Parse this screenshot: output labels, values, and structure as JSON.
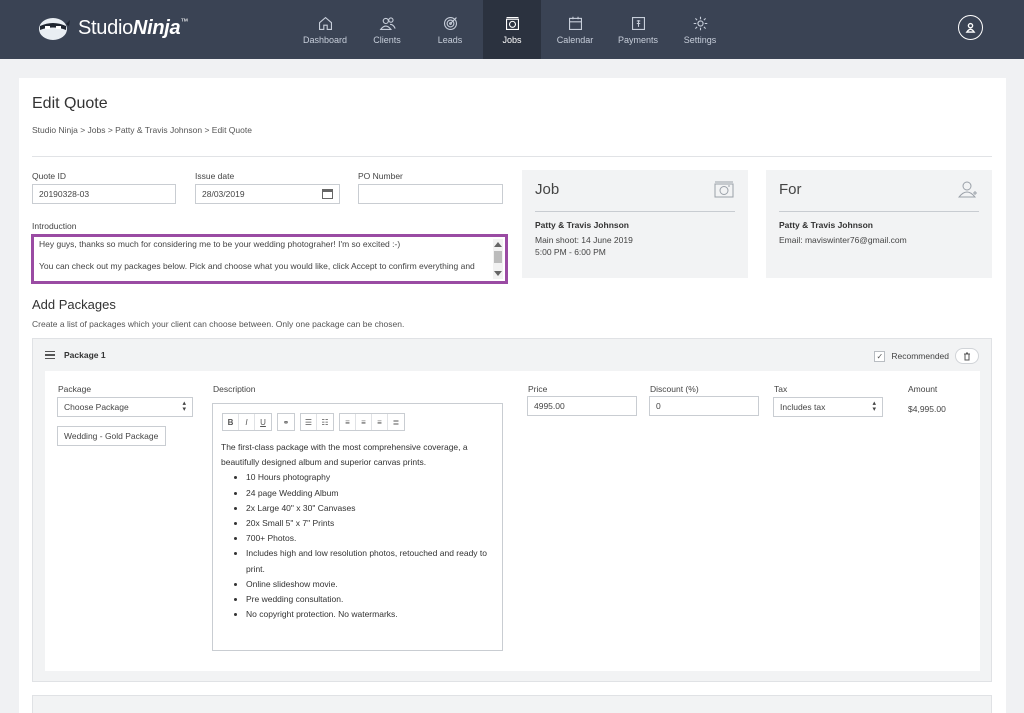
{
  "app": {
    "brand_prefix": "Studio",
    "brand_suffix": "Ninja",
    "brand_mark": "™"
  },
  "nav": [
    {
      "label": "Dashboard",
      "icon": "home-icon"
    },
    {
      "label": "Clients",
      "icon": "clients-icon"
    },
    {
      "label": "Leads",
      "icon": "target-icon"
    },
    {
      "label": "Jobs",
      "icon": "camera-icon",
      "active": true
    },
    {
      "label": "Calendar",
      "icon": "calendar-icon"
    },
    {
      "label": "Payments",
      "icon": "payments-icon"
    },
    {
      "label": "Settings",
      "icon": "gear-icon"
    }
  ],
  "page": {
    "title": "Edit Quote",
    "breadcrumb": "Studio Ninja  >  Jobs  >  Patty & Travis Johnson  >  Edit Quote"
  },
  "quote": {
    "id_label": "Quote ID",
    "id_value": "20190328-03",
    "issue_label": "Issue date",
    "issue_value": "28/03/2019",
    "po_label": "PO Number",
    "po_value": "",
    "intro_label": "Introduction",
    "intro_line1": "Hey guys, thanks so much for considering me to be your wedding photograher! I'm so excited :-)",
    "intro_line2": "",
    "intro_line3": "You can check out my packages below. Pick and choose what you would like, click Accept to confirm everything and"
  },
  "job_panel": {
    "title": "Job",
    "name": "Patty & Travis Johnson",
    "line1": "Main shoot: 14 June 2019",
    "line2": "5:00 PM - 6:00 PM"
  },
  "for_panel": {
    "title": "For",
    "name": "Patty & Travis Johnson",
    "line1": "Email: maviswinter76@gmail.com"
  },
  "packages_section": {
    "title": "Add Packages",
    "subtitle": "Create a list of packages which your client can choose between. Only one package can be chosen."
  },
  "package1": {
    "name": "Package 1",
    "recommended_label": "Recommended",
    "package_label": "Package",
    "package_select": "Choose Package",
    "package_name_value": "Wedding - Gold Package",
    "description_label": "Description",
    "description_intro": "The first-class package with the most comprehensive coverage, a beautifully designed album and superior canvas prints.",
    "description_items": [
      "10 Hours photography",
      "24 page Wedding Album",
      "2x Large 40\" x 30\" Canvases",
      "20x Small 5\" x 7\" Prints",
      "700+ Photos.",
      "Includes high and low resolution photos, retouched and ready to print.",
      "Online slideshow movie.",
      "Pre wedding consultation.",
      "No copyright protection. No watermarks."
    ],
    "price_label": "Price",
    "price_value": "4995.00",
    "discount_label": "Discount (%)",
    "discount_value": "0",
    "tax_label": "Tax",
    "tax_value": "Includes tax",
    "amount_label": "Amount",
    "amount_value": "$4,995.00"
  },
  "toolbar": {
    "bold": "B",
    "italic": "I",
    "underline": "U"
  },
  "colors": {
    "navbar": "#3a4354",
    "highlight": "#9a4ba3"
  }
}
